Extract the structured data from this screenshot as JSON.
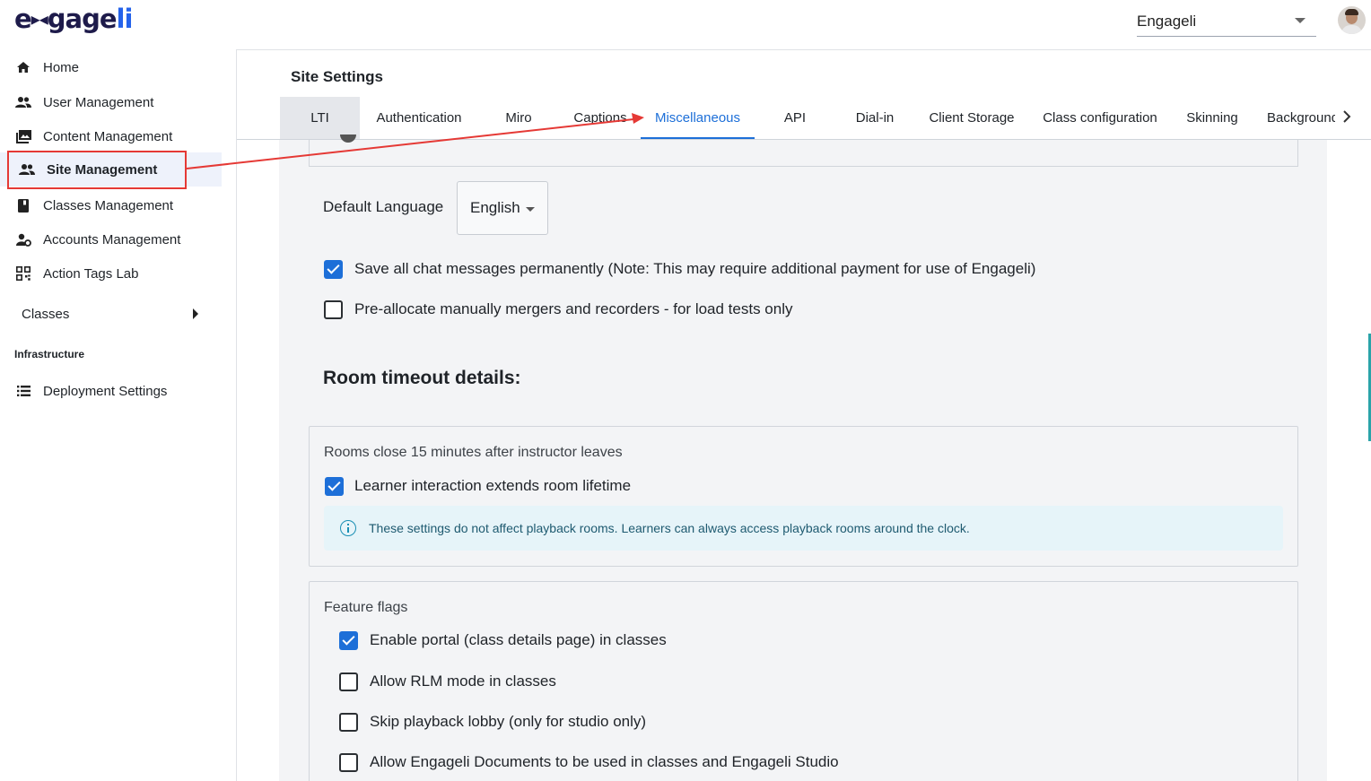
{
  "header": {
    "logo_text": "engageli",
    "org_select": {
      "value": "Engageli"
    }
  },
  "sidebar": {
    "items": [
      {
        "label": "Home",
        "icon": "home-icon"
      },
      {
        "label": "User Management",
        "icon": "users-icon"
      },
      {
        "label": "Content Management",
        "icon": "photo-library-icon"
      },
      {
        "label": "Site Management",
        "icon": "users-icon",
        "active": true
      },
      {
        "label": "Classes Management",
        "icon": "book-icon"
      },
      {
        "label": "Accounts Management",
        "icon": "account-settings-icon"
      },
      {
        "label": "Action Tags Lab",
        "icon": "qr-code-icon"
      }
    ],
    "classes_label": "Classes",
    "section_label": "Infrastructure",
    "infra_items": [
      {
        "label": "Deployment Settings",
        "icon": "list-icon"
      }
    ]
  },
  "main": {
    "title": "Site Settings",
    "tabs": [
      "LTI",
      "Authentication",
      "Miro",
      "Captions",
      "Miscellaneous",
      "API",
      "Dial-in",
      "Client Storage",
      "Class configuration",
      "Skinning",
      "Background"
    ],
    "active_tab": "Miscellaneous",
    "default_language_label": "Default Language",
    "default_language_value": "English",
    "save_chat": {
      "label": "Save all chat messages permanently (Note: This may require additional payment for use of Engageli)",
      "checked": true
    },
    "pre_allocate": {
      "label": "Pre-allocate manually mergers and recorders - for load tests only",
      "checked": false
    },
    "room_timeout_heading": "Room timeout details:",
    "room_timeout": {
      "title": "Rooms close 15 minutes after instructor leaves",
      "learner_interaction": {
        "label": "Learner interaction extends room lifetime",
        "checked": true
      },
      "info": "These settings do not affect playback rooms. Learners can always access playback rooms around the clock."
    },
    "feature_flags": {
      "title": "Feature flags",
      "items": [
        {
          "label": "Enable portal (class details page) in classes",
          "checked": true
        },
        {
          "label": "Allow RLM mode in classes",
          "checked": false
        },
        {
          "label": "Skip playback lobby (only for studio only)",
          "checked": false
        },
        {
          "label": "Allow Engageli Documents to be used in classes and Engageli Studio",
          "checked": false
        }
      ]
    }
  },
  "colors": {
    "accent": "#1d6fd8",
    "annotation": "#e53935",
    "info_bg": "#e6f4f9"
  }
}
